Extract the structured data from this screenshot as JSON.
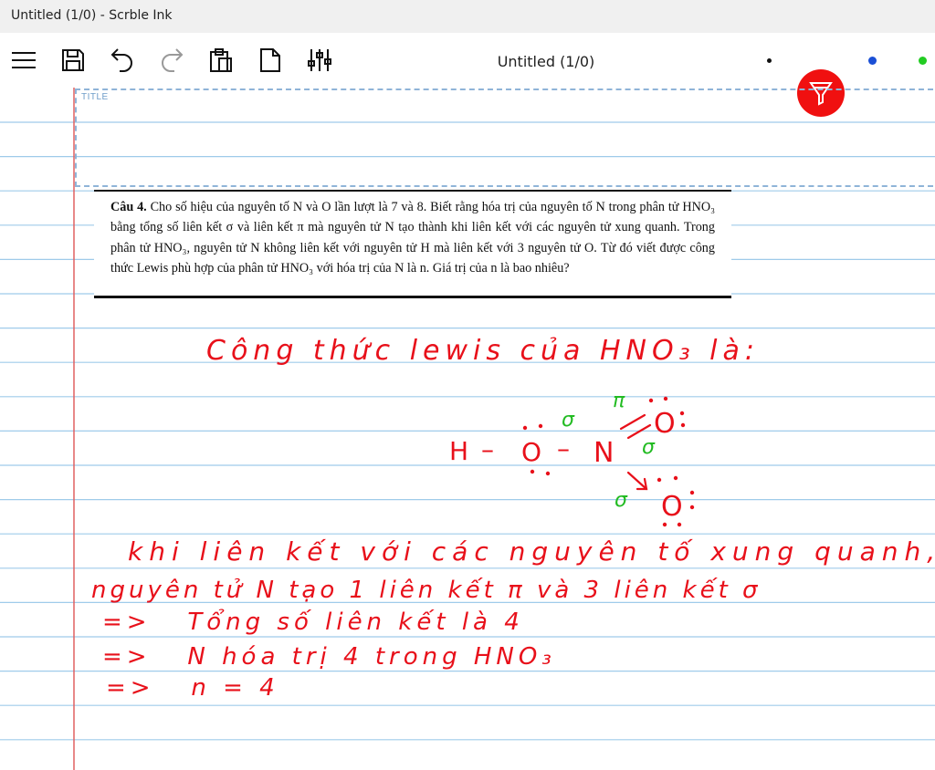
{
  "window": {
    "title": "Untitled (1/0) - Scrble Ink"
  },
  "toolbar": {
    "document_title": "Untitled (1/0)",
    "buttons": [
      "menu-icon",
      "save-icon",
      "undo-icon",
      "redo-icon",
      "paste-icon",
      "new-page-icon",
      "settings-sliders-icon"
    ],
    "pens": [
      {
        "color": "#111111",
        "icon": "pen-dot-black"
      },
      {
        "color": "#f01010",
        "icon": "highlighter-icon",
        "active": true
      },
      {
        "color": "#1a4fd6",
        "icon": "pen-dot-blue"
      },
      {
        "color": "#22cc22",
        "icon": "pen-dot-green"
      }
    ]
  },
  "page": {
    "title_placeholder": "TITLE",
    "line_color": "#9fcbea",
    "margin_color": "#e06060"
  },
  "question": {
    "label": "Câu 4.",
    "text": "Cho số hiệu của nguyên tố N và O lần lượt là 7 và 8. Biết rằng hóa trị của nguyên tố N trong phân tử HNO₃ bằng tổng số liên kết σ và liên kết π mà nguyên tử N tạo thành khi liên kết với các nguyên tử xung quanh. Trong phân tử HNO₃, nguyên tử N không liên kết với nguyên tử H mà liên kết với 3 nguyên tử O. Từ đó viết được công thức Lewis phù hợp của phân tử HNO₃ với hóa trị của N là n. Giá trị của n là bao nhiêu?"
  },
  "handwriting": {
    "heading": "Công thức lewis của HNO₃ là:",
    "lewis": {
      "h": "H",
      "o1": "O",
      "n": "N",
      "o2": "O",
      "o3": "O",
      "dash1": "–",
      "dash2": "–",
      "sigma1": "σ",
      "sigma2": "σ",
      "sigma3": "σ",
      "pi": "π"
    },
    "line1": "khi liên kết với các nguyên tố xung quanh,",
    "line2": "nguyên tử N tạo 1 liên kết π và 3 liên kết σ",
    "line3": "=>   Tổng số liên kết là 4",
    "line4": "=>   N hóa trị 4 trong HNO₃",
    "line5": "=>   n = 4"
  }
}
